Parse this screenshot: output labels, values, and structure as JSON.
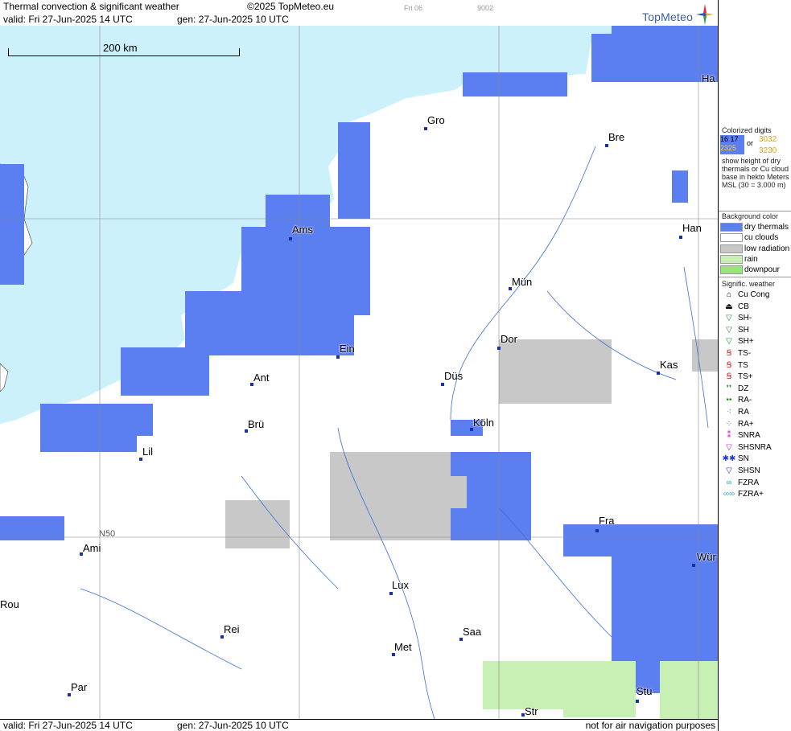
{
  "header": {
    "title": "Thermal convection & significant weather",
    "copyright": "©2025 TopMeteo.eu",
    "valid": "valid:  Fri  27-Jun-2025  14 UTC",
    "gen": "gen: 27-Jun-2025 10 UTC",
    "tiny_day": "Fri 06",
    "tiny_code": "9002",
    "logo_text": "TopMeteo"
  },
  "footer": {
    "valid": "valid:  Fri  27-Jun-2025  14 UTC",
    "gen": "gen: 27-Jun-2025 10 UTC",
    "disclaimer": "not for air navigation purposes"
  },
  "map": {
    "scale_label": "200 km",
    "lat_label": "N50",
    "cities": [
      {
        "name": "Gro"
      },
      {
        "name": "Bre"
      },
      {
        "name": "Ams"
      },
      {
        "name": "Han"
      },
      {
        "name": "Mün"
      },
      {
        "name": "Ein"
      },
      {
        "name": "Dor"
      },
      {
        "name": "Ant"
      },
      {
        "name": "Düs"
      },
      {
        "name": "Kas"
      },
      {
        "name": "Brü"
      },
      {
        "name": "Köln"
      },
      {
        "name": "Lil"
      },
      {
        "name": "Fra"
      },
      {
        "name": "Ami"
      },
      {
        "name": "Lux"
      },
      {
        "name": "Wür"
      },
      {
        "name": "Rei"
      },
      {
        "name": "Saa"
      },
      {
        "name": "Met"
      },
      {
        "name": "Par"
      },
      {
        "name": "Stu"
      },
      {
        "name": "Str"
      },
      {
        "name": "Ha"
      },
      {
        "name": "Rou"
      }
    ]
  },
  "legend": {
    "colorized_title": "Colorized digits",
    "sample_a": "16 17",
    "sample_b": "3032",
    "or": "or",
    "sample_c": "2325",
    "sample_d": "3230",
    "description": "show height of dry thermals or Cu cloud base in hekto Meters MSL (30 = 3.000 m)",
    "bg_title": "Background color",
    "bg_items": [
      {
        "label": "dry thermals",
        "color": "#5b7ef0"
      },
      {
        "label": "cu clouds",
        "color": "#ffffff"
      },
      {
        "label": "low radiation",
        "color": "#c8c8c8"
      },
      {
        "label": "rain",
        "color": "#c8f0b4"
      },
      {
        "label": "downpour",
        "color": "#96e678"
      }
    ],
    "wx_title": "Signific. weather",
    "wx_items": [
      {
        "label": "Cu Cong",
        "symbol": "⌂",
        "color": "#000000"
      },
      {
        "label": "CB",
        "symbol": "⏏",
        "color": "#000000"
      },
      {
        "label": "SH-",
        "symbol": "▽",
        "color": "#2a8a2a"
      },
      {
        "label": "SH",
        "symbol": "▽",
        "color": "#2a8a2a"
      },
      {
        "label": "SH+",
        "symbol": "▽",
        "color": "#2a8a2a"
      },
      {
        "label": "TS-",
        "symbol": "Ꞩ",
        "color": "#d02020"
      },
      {
        "label": "TS",
        "symbol": "Ꞩ",
        "color": "#d02020"
      },
      {
        "label": "TS+",
        "symbol": "Ꞩ",
        "color": "#d02020"
      },
      {
        "label": "DZ",
        "symbol": "❜❜",
        "color": "#2a8a2a"
      },
      {
        "label": "RA-",
        "symbol": "••",
        "color": "#2a8a2a"
      },
      {
        "label": "RA",
        "symbol": "⁖",
        "color": "#2a8a2a"
      },
      {
        "label": "RA+",
        "symbol": "⁘",
        "color": "#2a8a2a"
      },
      {
        "label": "SNRA",
        "symbol": "⁑",
        "color": "#c020c0"
      },
      {
        "label": "SHSNRA",
        "symbol": "▽",
        "color": "#c020c0"
      },
      {
        "label": "SN",
        "symbol": "✱✱",
        "color": "#2040c0"
      },
      {
        "label": "SHSN",
        "symbol": "▽",
        "color": "#2040c0"
      },
      {
        "label": "FZRA",
        "symbol": "∞",
        "color": "#20b0d0"
      },
      {
        "label": "FZRA+",
        "symbol": "∞∞",
        "color": "#20b0d0"
      }
    ]
  }
}
